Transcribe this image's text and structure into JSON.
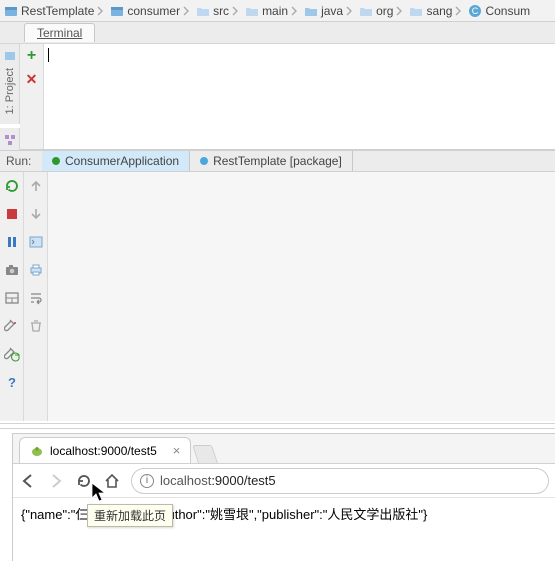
{
  "breadcrumb": [
    {
      "icon": "module",
      "label": "RestTemplate"
    },
    {
      "icon": "module",
      "label": "consumer"
    },
    {
      "icon": "folder",
      "label": "src"
    },
    {
      "icon": "folder",
      "label": "main"
    },
    {
      "icon": "folder",
      "label": "java"
    },
    {
      "icon": "folder",
      "label": "org"
    },
    {
      "icon": "folder",
      "label": "sang"
    },
    {
      "icon": "class",
      "label": "Consum"
    }
  ],
  "sidebar_tabs": {
    "project": "1: Project",
    "structure": "7: Structure"
  },
  "terminal": {
    "tab_label": "Terminal",
    "gutter": {
      "add": "+",
      "close": "✕"
    }
  },
  "run": {
    "label": "Run:",
    "tabs": [
      {
        "name": "ConsumerApplication",
        "dot_color": "#2e9a2e",
        "active": true
      },
      {
        "name": "RestTemplate [package]",
        "dot_color": "#4aa7de",
        "active": false
      }
    ],
    "col1_icons": [
      "rerun",
      "stop",
      "pause",
      "camera",
      "debug-stack",
      "attach",
      "restart-run",
      "help"
    ],
    "col2_icons": [
      "up-arrow",
      "down-arrow",
      "console",
      "print",
      "wrap",
      "trash"
    ]
  },
  "browser": {
    "tab_title": "localhost:9000/test5",
    "url_host": "localhost",
    "url_rest": ":9000/test5",
    "reload_tooltip": "重新加载此页",
    "response_text": "{\"name\":\"仨\",\"price\":55,\"author\":\"姚雪垠\",\"publisher\":\"人民文学出版社\"}"
  }
}
